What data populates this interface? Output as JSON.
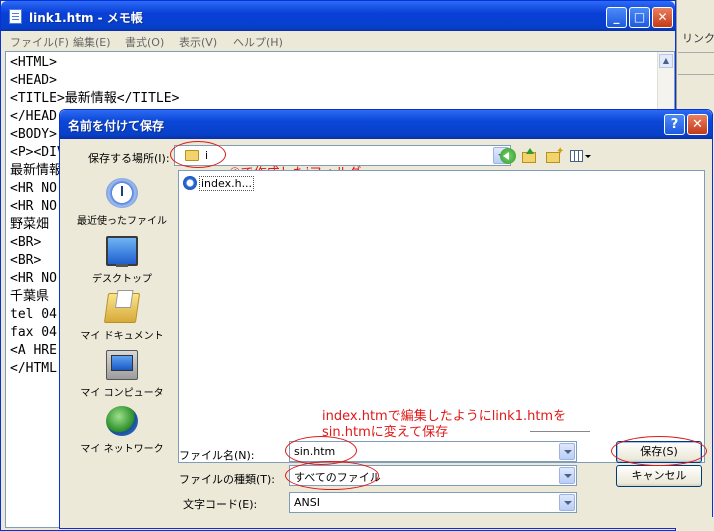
{
  "background": {
    "link_menu_text": "リンク"
  },
  "notepad": {
    "title": "link1.htm - メモ帳",
    "menu": [
      "ファイル(F)",
      "編集(E)",
      "書式(O)",
      "表示(V)",
      "ヘルプ(H)"
    ],
    "lines": [
      "<HTML>",
      "<HEAD>",
      "<TITLE>最新情報</TITLE>",
      "</HEAD",
      "<BODY>",
      "<P><DIV",
      "最新情報",
      "<HR NO",
      "<HR NO",
      "野菜畑",
      "<BR>",
      "<BR>",
      "<HR NO",
      "千葉県",
      "tel 04",
      "fax 04",
      "<A HRE",
      "</HTML"
    ]
  },
  "dialog": {
    "title": "名前を付けて保存",
    "help_label": "?",
    "close_label": "✕",
    "lookin_label": "保存する場所(I):",
    "lookin_value": "i",
    "places": [
      {
        "label": "最近使ったファイル",
        "icon": "recent-icon"
      },
      {
        "label": "デスクトップ",
        "icon": "desktop-icon"
      },
      {
        "label": "マイ ドキュメント",
        "icon": "my-documents-icon"
      },
      {
        "label": "マイ コンピュータ",
        "icon": "my-computer-icon"
      },
      {
        "label": "マイ ネットワーク",
        "icon": "my-network-icon"
      }
    ],
    "file_list": [
      {
        "name": "index.h..."
      }
    ],
    "filename_label": "ファイル名(N):",
    "filename_value": "sin.htm",
    "filetype_label": "ファイルの種類(T):",
    "filetype_value": "すべてのファイル",
    "encoding_label": "文字コード(E):",
    "encoding_value": "ANSI",
    "save_button": "保存(S)",
    "cancel_button": "キャンセル"
  },
  "annotations": {
    "folder_note": "④で作成したiフォルダ",
    "save_note_line1": "index.htmで編集したようにlink1.htmを",
    "save_note_line2": "sin.htmに変えて保存"
  },
  "colors": {
    "annotation": "#e01818",
    "titlebar": "#0a46d6"
  }
}
